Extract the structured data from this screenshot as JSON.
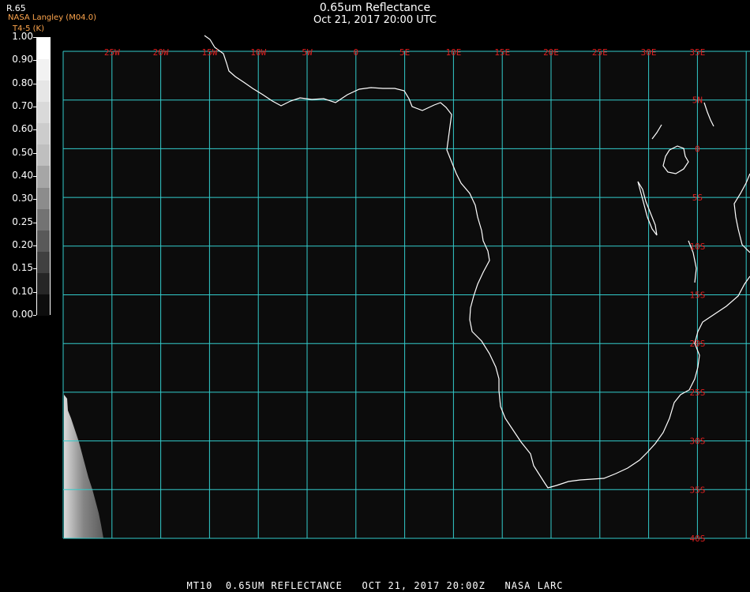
{
  "header": {
    "title": "0.65um Reflectance",
    "subtitle": "Oct 21, 2017 20:00 UTC"
  },
  "colorbar": {
    "name": "R.65",
    "org": "NASA Langley (M04.0)",
    "product": "T4-5 (K)",
    "ticks": [
      "1.00",
      "0.90",
      "0.80",
      "0.70",
      "0.60",
      "0.50",
      "0.40",
      "0.30",
      "0.25",
      "0.20",
      "0.15",
      "0.10",
      "0.00"
    ],
    "colors": [
      "#ffffff",
      "#f2f2f2",
      "#e6e6e6",
      "#d9d9d9",
      "#cccccc",
      "#bfbfbf",
      "#a6a6a6",
      "#8c8c8c",
      "#737373",
      "#595959",
      "#404040",
      "#262626",
      "#0d0d0d"
    ]
  },
  "map": {
    "grid_color": "#33cccc",
    "label_color": "#e02020",
    "coast_color": "#ffffff",
    "background": "#0c0c0c",
    "lon_labels": [
      "25W",
      "20W",
      "15W",
      "10W",
      "5W",
      "0",
      "5E",
      "10E",
      "15E",
      "20E",
      "25E",
      "30E",
      "35E"
    ],
    "lat_labels": [
      "5N",
      "0",
      "5S",
      "10S",
      "15S",
      "20S",
      "25S",
      "30S",
      "35S",
      "40S"
    ]
  },
  "footer": {
    "text": "MT10  0.65UM REFLECTANCE   OCT 21, 2017 20:00Z   NASA LARC"
  }
}
